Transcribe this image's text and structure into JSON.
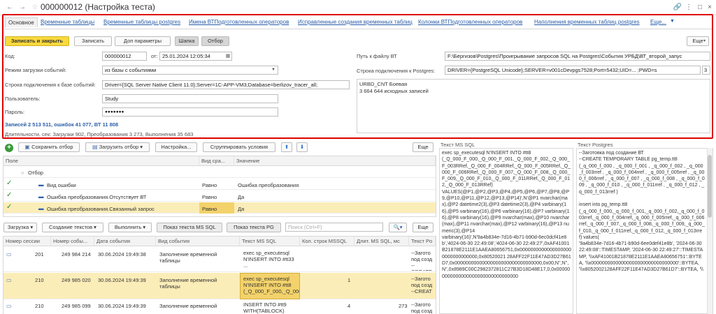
{
  "window": {
    "title": "000000012 (Настройка теста)",
    "back": "←",
    "forward": "→",
    "star": "☆",
    "link": "🔗",
    "more": "⋮",
    "restore": "□",
    "close": "×"
  },
  "tabs": [
    "Основное",
    "Временные таблицы",
    "Временные таблицы postgres",
    "Имена ВТПодготовленных операторов",
    "Исправленные создания временных таблиц",
    "Колонки ВТПодготовленных операторов",
    "Наполнения временных таблиц postgres",
    "Еще..."
  ],
  "toolbar": {
    "save_close": "Записать и закрыть",
    "save": "Записать",
    "extra_params": "Доп параметры",
    "template": "Шапка",
    "filter": "Отбор",
    "more": "Еще"
  },
  "form": {
    "code_label": "Код:",
    "code_value": "000000012",
    "from_label": "от:",
    "from_value": "25.01.2024 12:05:34",
    "mode_label": "Режим загрузки событий:",
    "mode_value": "из базы с событиями",
    "conn_label": "Строка подключения к базе событий:",
    "conn_value": "Driver={SQL Server Native Client 11.0};Server=1C-APP-VM3;Database=berlizov_tracer_all;",
    "user_label": "Пользователь:",
    "user_value": "Study",
    "pass_label": "Пароль:",
    "pass_value": "●●●●●●●",
    "records": "Записей 2 513 511, ошибок 41 077, ВТ 11 808",
    "duration": "Длительности, сек: Загрузки 902, Преобразования 3 273, Выполнения 35 683",
    "bt_path_label": "Путь к файлу ВТ",
    "bt_path_value": "F:\\Бергизов\\Postgres\\Проигрывание запросов SQL на Postgres\\События УРБД\\ВТ_второй_запус",
    "pg_conn_label": "Строка подключения к Postgres:",
    "pg_conn_value": "DRIVER={PostgreSQL Unicode};SERVER=v001cDevpgs7528;Port=5432;UID=...       ;PWD=s",
    "pg_conn_extra": "3",
    "info_text": "URBD_CNT Боевая\n3 664 644 исходных записей"
  },
  "filter_toolbar": {
    "add_icon": "+",
    "save_filter": "Сохранить отбор",
    "load_filter": "Загрузить отбор",
    "settings": "Настройка...",
    "group": "Сгруппировать условия",
    "up": "⬆",
    "down": "⬇",
    "more": "Еще"
  },
  "filter_table": {
    "headers": [
      "Поле",
      "Вид сра...",
      "Значение"
    ],
    "root": "Отбор",
    "rows": [
      {
        "field": "Вид ошибки",
        "comp": "Равно",
        "value": "Ошибка преобразования",
        "selected": false
      },
      {
        "field": "Ошибка преобразования.Отсутствует ВТ",
        "comp": "Равно",
        "value": "Да",
        "selected": false
      },
      {
        "field": "Ошибка преобразования.Связанный запрос",
        "comp": "Равно",
        "value": "Да",
        "selected": true
      }
    ]
  },
  "events_toolbar": {
    "load": "Загрузка",
    "create_texts": "Создание текстов",
    "execute": "Выполнить",
    "show_ms": "Показ текста MS SQL",
    "show_pg": "Показ текста PG",
    "search_placeholder": "Поиск (Ctrl+F)",
    "more": "Еще"
  },
  "events_table": {
    "headers": [
      "Номер сессии",
      "Номер собы...",
      "Дата события",
      "Вид события",
      "Текст MS SQL",
      "Кол. строк MSSQL",
      "Длит. MS SQL, мс",
      "Текст Po"
    ],
    "rows": [
      {
        "session": "201",
        "num": "249 984 214",
        "date": "30.06.2024 19:49:38",
        "kind": "Заполнение временной таблицы",
        "ms": "exec sp_executesql N'INSERT INTO #tt33 ...",
        "count": "",
        "dur": "",
        "pg": "--Загото под созд --CREATE",
        "selected": false
      },
      {
        "session": "210",
        "num": "249 985 020",
        "date": "30.06.2024 19:49:39",
        "kind": "Заполнение временной таблицы",
        "ms": "exec sp_executesql N'INSERT INTO #tt8 (_Q_000_F_000,_Q_000",
        "count": "1",
        "dur": "",
        "pg": "--Загото под созд --CREAT",
        "selected": true
      },
      {
        "session": "210",
        "num": "249 985 099",
        "date": "30.06.2024 19:49:39",
        "kind": "Заполнение временной",
        "ms": "INSERT INTO #tt9 WITH(TABLOCK)",
        "count": "4",
        "dur": "273",
        "pg": "--Загото под созд",
        "selected": false
      }
    ]
  },
  "ms_panel": {
    "title": "Текст MS SQL",
    "text": "exec sp_executesql N'INSERT INTO #tt8\n(_Q_000_F_000,_Q_000_F_001,_Q_000_F_002,_Q_000_F_003RRef,_Q_000_F_004RRef,_Q_000_F_005RRef,_Q_000_F_006RRef,_Q_000_F_007,_Q_000_F_008,_Q_000_F_009,_Q_000_F_010,_Q_000_F_011RRef,_Q_000_F_012,_Q_000_F_013RRef)\nVALUES(@P1,@P2,@P3,@P4,@P5,@P6,@P7,@P8,@P9,@P10,@P11,@P12,@P13,@P14)',N'@P1 nvarchar(max),@P2 datetime2(3),@P3 datetime2(3),@P4 varbinary(16),@P5 varbinary(16),@P6 varbinary(16),@P7 varbinary(16),@P8 varbinary(16),@P9 nvarchar(max),@P10 nvarchar(max),@P11 nvarchar(max),@P12 varbinary(16),@P13 numeric(3),@P14\nvarbinary(16)',N'9a4b834e-7d16-4b71-b90d-6ec0dcf41e8b','4024-06-30 22:49:08','4024-06-30 22:49:27',0xAF41001B21878E2111E1AAEA80656751,0x00000000000000000000000000000000,0x80520021 28AFF22F11E47AD3D27B61D7,0x00000000000000000000000000000000,0x00,N'',N'',N'',0x8989C00C2982372811C27B3D18D48E17,0,0x000000000000000000000000000000000"
  },
  "pg_panel": {
    "title": "Текст Postgres",
    "text": "--Заготовка под создание ВТ\n--CREATE TEMPORARY TABLE pg_temp.tt8\n(_q_000_f_000 , _q_000_f_001 , _q_000_f_002 , _q_000_f_003rref , _q_000_f_004rref , _q_000_f_005rref , _q_000_f_006rref , _q_000_f_007 , _q_000_f_008 , _q_000_f_009 , _q_000_f_010 , _q_000_f_011rref , _q_000_f_012 , _q_000_f_013rref )\n\ninsert into pg_temp.tt8\n(_q_000_f_000,_q_000_f_001,_q_000_f_002,_q_000_f_003rref,_q_000_f_004rref,_q_000_f_005rref,_q_000_f_006rref,_q_000_f_007,_q_000_f_008,_q_000_f_009,_q_000_f_010,_q_000_f_011rref,_q_000_f_012,_q_000_f_013rref) values(\n'9a4b834e-7d16-4b71-b90d-6ee0def41e8b', '2024-06-30 22:49:08'::TIMESTAMP, '2024-06-30 22:49:27'::TIMESTAMP, '\\\\xAF41001B21878E2111E1AAEA80656751'::BYTEA, '\\\\x00000000000000000000000000000000'::BYTEA, '\\\\x8052002128AFF22F11E47AD3D27B61D7'::BYTEA, '\\\\"
  }
}
